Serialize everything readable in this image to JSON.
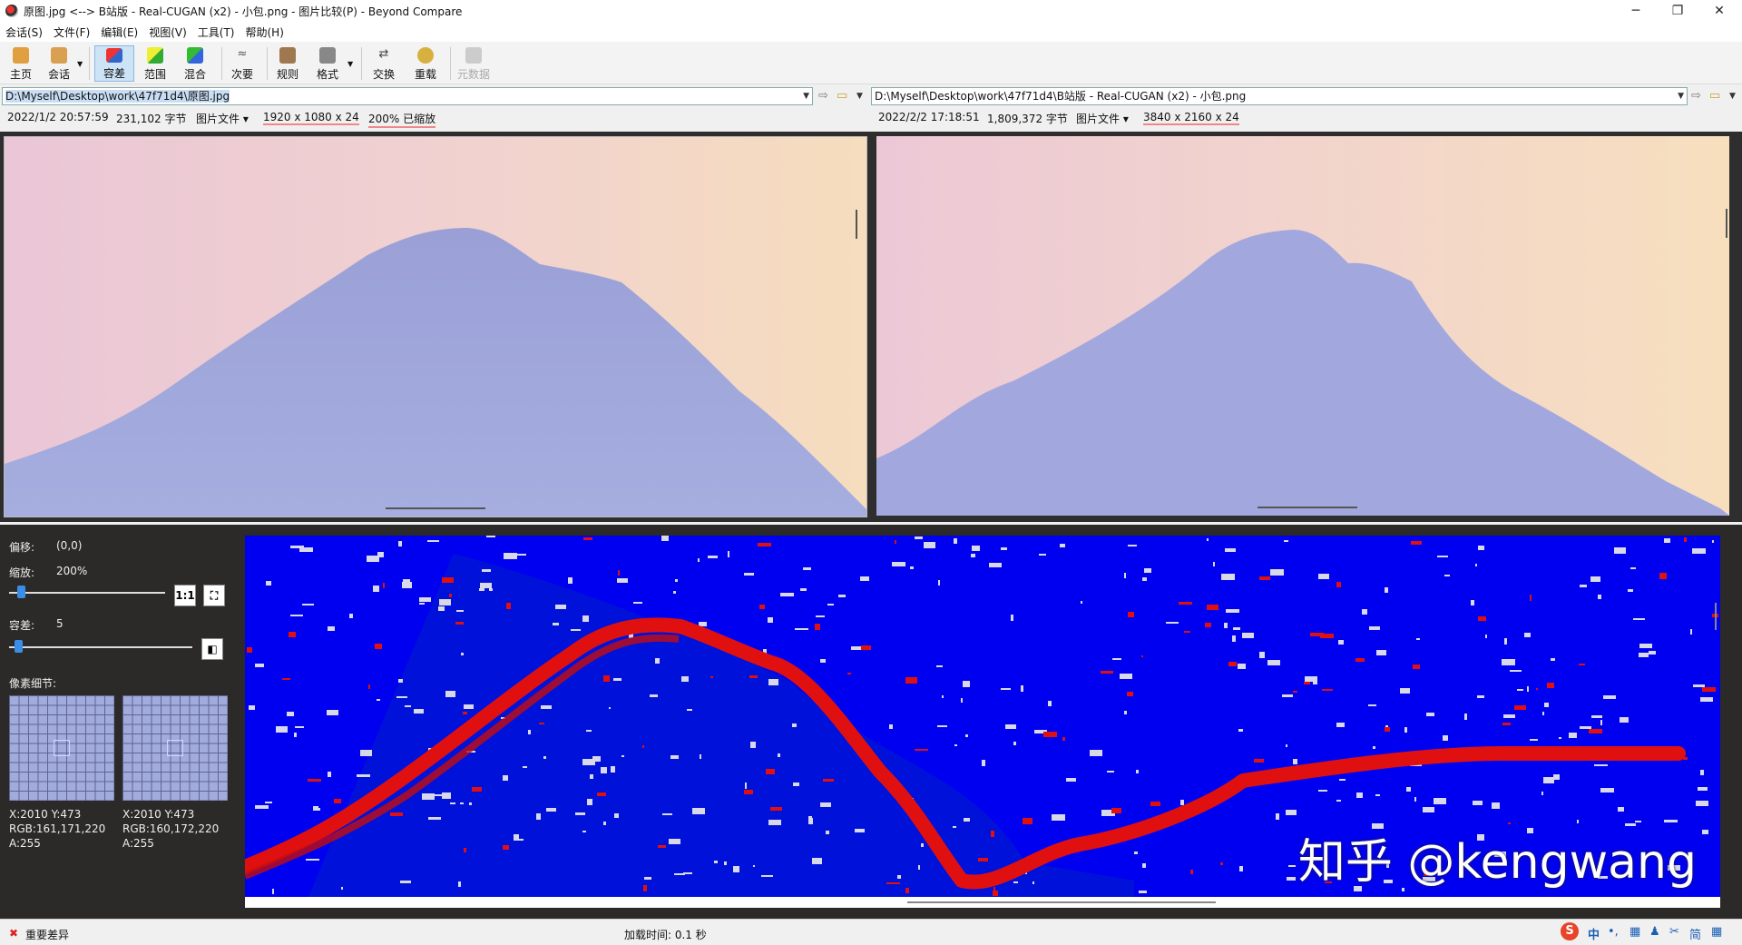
{
  "window": {
    "title": "原图.jpg <--> B站版 - Real-CUGAN (x2) - 小包.png - 图片比较(P) - Beyond Compare",
    "minimize": "─",
    "maximize": "❐",
    "close": "✕"
  },
  "menu": [
    "会话(S)",
    "文件(F)",
    "编辑(E)",
    "视图(V)",
    "工具(T)",
    "帮助(H)"
  ],
  "toolbar": {
    "home": "主页",
    "session": "会话",
    "tolerance": "容差",
    "range": "范围",
    "blend": "混合",
    "minor": "次要",
    "rules": "规则",
    "format": "格式",
    "swap": "交换",
    "reload": "重载",
    "metadata": "元数据"
  },
  "left": {
    "path": "D:\\Myself\\Desktop\\work\\47f71d4\\原图.jpg",
    "date": "2022/1/2 20:57:59",
    "size": "231,102 字节",
    "filetype": "图片文件",
    "dims": "1920 x 1080 x 24",
    "zoom": "200% 已缩放"
  },
  "right": {
    "path": "D:\\Myself\\Desktop\\work\\47f71d4\\B站版 - Real-CUGAN (x2) - 小包.png",
    "date": "2022/2/2 17:18:51",
    "size": "1,809,372 字节",
    "filetype": "图片文件",
    "dims": "3840 x 2160 x 24"
  },
  "controls": {
    "offset_label": "偏移:",
    "offset_value": "(0,0)",
    "zoom_label": "缩放:",
    "zoom_value": "200%",
    "zoom_slider_pct": 5,
    "btn_1to1": "1:1",
    "tolerance_label": "容差:",
    "tolerance_value": "5",
    "tolerance_slider_pct": 3,
    "pixel_detail_label": "像素细节:",
    "px1_xy": "X:2010 Y:473",
    "px1_rgb": "RGB:161,171,220",
    "px1_a": "A:255",
    "px2_xy": "X:2010 Y:473",
    "px2_rgb": "RGB:160,172,220",
    "px2_a": "A:255"
  },
  "watermark": "知乎 @kengwang",
  "status": {
    "diff_label": "重要差异",
    "load_time": "加载时间:  0.1 秒"
  },
  "tray": {
    "ime_logo": "S",
    "ime_mode": "中",
    "punct": "•,",
    "keyboard": "▦",
    "user": "♟",
    "tools": "✂",
    "simplified": "简",
    "grid": "▦"
  },
  "colors": {
    "diff_background": "#0000f0",
    "diff_major": "#e01010",
    "diff_minor": "#d8d8e8",
    "accent": "#3a8ee8"
  }
}
